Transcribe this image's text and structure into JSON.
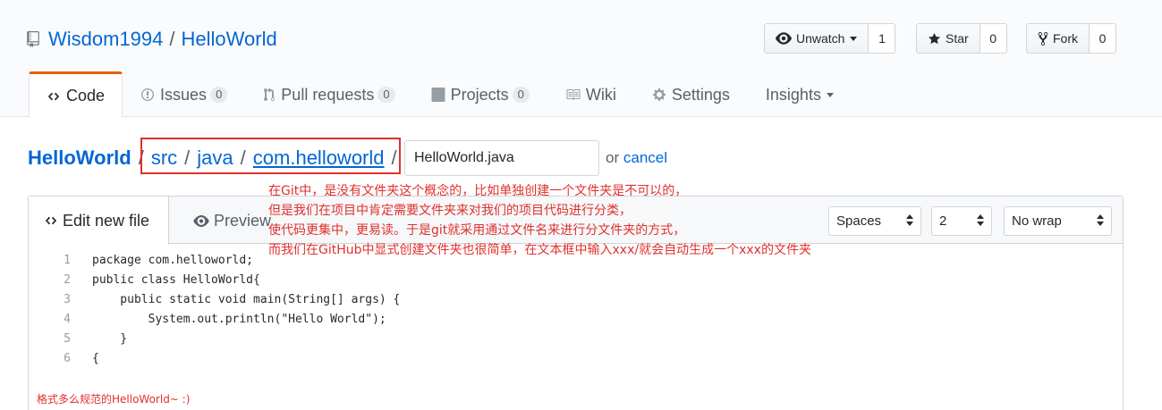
{
  "repo": {
    "owner": "Wisdom1994",
    "separator": "/",
    "name": "HelloWorld"
  },
  "actions": {
    "watch": {
      "label": "Unwatch",
      "count": "1"
    },
    "star": {
      "label": "Star",
      "count": "0"
    },
    "fork": {
      "label": "Fork",
      "count": "0"
    }
  },
  "tabs": [
    {
      "label": "Code",
      "icon": "code-icon"
    },
    {
      "label": "Issues",
      "count": "0",
      "icon": "issue-icon"
    },
    {
      "label": "Pull requests",
      "count": "0",
      "icon": "pull-request-icon"
    },
    {
      "label": "Projects",
      "count": "0",
      "icon": "project-icon"
    },
    {
      "label": "Wiki",
      "icon": "book-icon"
    },
    {
      "label": "Settings",
      "icon": "gear-icon"
    },
    {
      "label": "Insights",
      "icon": "chevron-down-icon"
    }
  ],
  "breadcrumb": {
    "root": "HelloWorld",
    "path": [
      "src",
      "java",
      "com.helloworld"
    ],
    "slash": "/"
  },
  "filename": {
    "value": "HelloWorld.java"
  },
  "cancel": {
    "or": "or",
    "link": "cancel"
  },
  "editor": {
    "tab_edit": "Edit new file",
    "tab_preview": "Preview",
    "indent_mode": "Spaces",
    "indent_size": "2",
    "wrap_mode": "No wrap",
    "lines": [
      {
        "n": "1",
        "text": "package com.helloworld;"
      },
      {
        "n": "2",
        "text": "public class HelloWorld{"
      },
      {
        "n": "3",
        "text": "    public static void main(String[] args) {"
      },
      {
        "n": "4",
        "text": "        System.out.println(\"Hello World\");"
      },
      {
        "n": "5",
        "text": "    }"
      },
      {
        "n": "6",
        "text": "{"
      }
    ]
  },
  "annotation": [
    "在Git中，是没有文件夹这个概念的，比如单独创建一个文件夹是不可以的，",
    "但是我们在项目中肯定需要文件夹来对我们的项目代码进行分类，",
    "使代码更集中，更易读。于是git就采用通过文件名来进行分文件夹的方式，",
    "而我们在GitHub中显式创建文件夹也很简单，在文本框中输入xxx/就会自动生成一个xxx的文件夹"
  ],
  "footer_note": "格式多么规范的HelloWorld~ :)",
  "colors": {
    "link": "#0366d6",
    "accent_tab": "#e36209",
    "annotation": "#e0302c"
  }
}
